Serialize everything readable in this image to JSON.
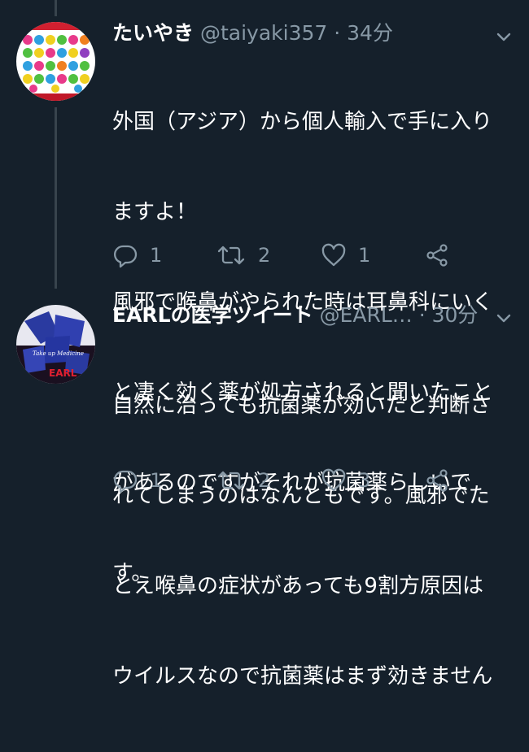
{
  "tweets": [
    {
      "name": "たいやき",
      "handle": "@taiyaki357",
      "dot": "·",
      "time": "34分",
      "lines": [
        "外国（アジア）から個人輸入で手に入り",
        "ますよ！",
        "風邪で喉鼻がやられた時は耳鼻科にいく",
        "と凄く効く薬が処方されると聞いたこと",
        "があるのですがそれが抗菌薬らしいで",
        "す。"
      ],
      "reply_count": "1",
      "retweet_count": "2",
      "like_count": "1"
    },
    {
      "name": "EARLの医学ツイート",
      "handle": "@EARL…",
      "dot": "·",
      "time": "30分",
      "lines": [
        "自然に治っても抗菌薬が効いたと判断さ",
        "れてしまうのはなんともです。風邪でた",
        "とえ喉鼻の症状があっても9割方原因は",
        "ウイルスなので抗菌薬はまず効きません"
      ],
      "avatar_text": "EARL",
      "reply_count": "1",
      "retweet_count": "2",
      "like_count": "3"
    }
  ],
  "colors": {
    "background": "#15202b",
    "secondary_text": "#8899a6",
    "divider": "#38444d"
  },
  "icons": [
    "reply-icon",
    "retweet-icon",
    "like-icon",
    "share-icon",
    "chevron-down-icon"
  ]
}
